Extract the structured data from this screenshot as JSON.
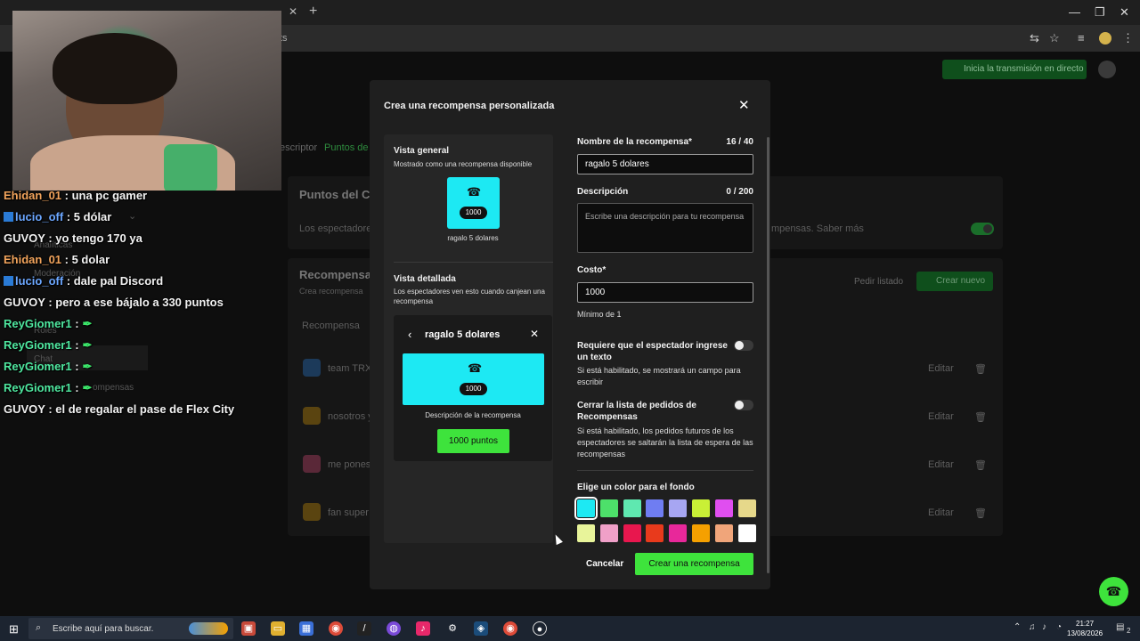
{
  "browser": {
    "url_fragment": "ts",
    "win_minimize": "—",
    "win_restore": "❐",
    "win_close": "✕"
  },
  "background_page": {
    "go_live": "Inicia la transmisión en directo",
    "tab_partial_1": "escriptor",
    "tab_partial_2": "Puntos de",
    "section_title": "Puntos del Ca",
    "section_desc": "Los espectadores",
    "section_desc_right": "mpensas. Saber más",
    "rewards_title": "Recompensas",
    "rewards_sub": "Crea recompensa",
    "request_list": "Pedir listado",
    "create_new": "Crear nuevo",
    "col_reward": "Recompensa",
    "rows": [
      {
        "name": "team TRX",
        "edit": "Editar"
      },
      {
        "name": "nosotros y",
        "edit": "Editar"
      },
      {
        "name": "me pones",
        "edit": "Editar"
      },
      {
        "name": "fan super a",
        "edit": "Editar"
      }
    ],
    "side_items": [
      "Analíticas",
      "Moderación",
      "Roles",
      "Chat",
      "ompensas"
    ]
  },
  "chat": [
    {
      "user": "Ehidan_01",
      "color": "#f2a45c",
      "badge": false,
      "msg": " : una pc gamer"
    },
    {
      "user": "lucio_off",
      "color": "#6ca7ff",
      "badge": true,
      "msg": " : 5 dólar"
    },
    {
      "user": "GUVOY",
      "color": "#f2f2f2",
      "badge": false,
      "msg": " : yo tengo 170 ya"
    },
    {
      "user": "Ehidan_01",
      "color": "#f2a45c",
      "badge": false,
      "msg": " : 5 dolar"
    },
    {
      "user": "lucio_off",
      "color": "#6ca7ff",
      "badge": true,
      "msg": " : dale pal Discord"
    },
    {
      "user": "GUVOY",
      "color": "#f2f2f2",
      "badge": false,
      "msg": " : pero a ese bájalo a 330 puntos"
    },
    {
      "user": "ReyGiomer1",
      "color": "#4fe8a0",
      "badge": false,
      "msg": " :"
    },
    {
      "user": "ReyGiomer1",
      "color": "#4fe8a0",
      "badge": false,
      "msg": " :"
    },
    {
      "user": "ReyGiomer1",
      "color": "#4fe8a0",
      "badge": false,
      "msg": " :"
    },
    {
      "user": "ReyGiomer1",
      "color": "#4fe8a0",
      "badge": false,
      "msg": " :"
    },
    {
      "user": "GUVOY",
      "color": "#f2f2f2",
      "badge": false,
      "msg": " : el de regalar el pase de Flex City"
    }
  ],
  "chat_emote_glyph": "✒",
  "modal": {
    "title": "Crea una recompensa personalizada",
    "close": "✕",
    "overview_title": "Vista general",
    "overview_sub": "Mostrado como una recompensa disponible",
    "tile_cost": "1000",
    "tile_name": "ragalo 5 dolares",
    "detail_title": "Vista detallada",
    "detail_sub": "Los espectadores ven esto cuando canjean una recompensa",
    "card_title": "ragalo 5 dolares",
    "card_desc": "Descripción de la recompensa",
    "card_button": "1000 puntos",
    "name_label": "Nombre de la recompensa*",
    "name_count": "16 / 40",
    "name_value": "ragalo 5 dolares",
    "desc_label": "Descripción",
    "desc_count": "0 / 200",
    "desc_placeholder": "Escribe una descripción para tu recompensa",
    "cost_label": "Costo*",
    "cost_value": "1000",
    "cost_min": "Mínimo de 1",
    "req_text_label": "Requiere que el espectador ingrese un texto",
    "req_text_hint": "Si está habilitado, se mostrará un campo para escribir",
    "req_text_enabled": false,
    "close_list_label": "Cerrar la lista de pedidos de Recompensas",
    "close_list_hint": "Si está habilitado, los pedidos futuros de los espectadores se saltarán la lista de espera de las recompensas",
    "close_list_enabled": false,
    "color_label": "Elige un color para el fondo",
    "colors": [
      "#1de9f3",
      "#4de06a",
      "#5fe8b0",
      "#6f7df2",
      "#a7a6f2",
      "#c9f036",
      "#e04ef0",
      "#e6d88a",
      "#e8f49a",
      "#f0a0c8",
      "#e8174e",
      "#e83a1c",
      "#e8289a",
      "#f5a000",
      "#f0a57a",
      "#ffffff"
    ],
    "selected_color": "#1de9f3",
    "cancel": "Cancelar",
    "create": "Crear una recompensa"
  },
  "taskbar": {
    "search_placeholder": "Escribe aquí para buscar.",
    "time": "21:27",
    "date": "13/08/2026",
    "notif_count": "2"
  }
}
